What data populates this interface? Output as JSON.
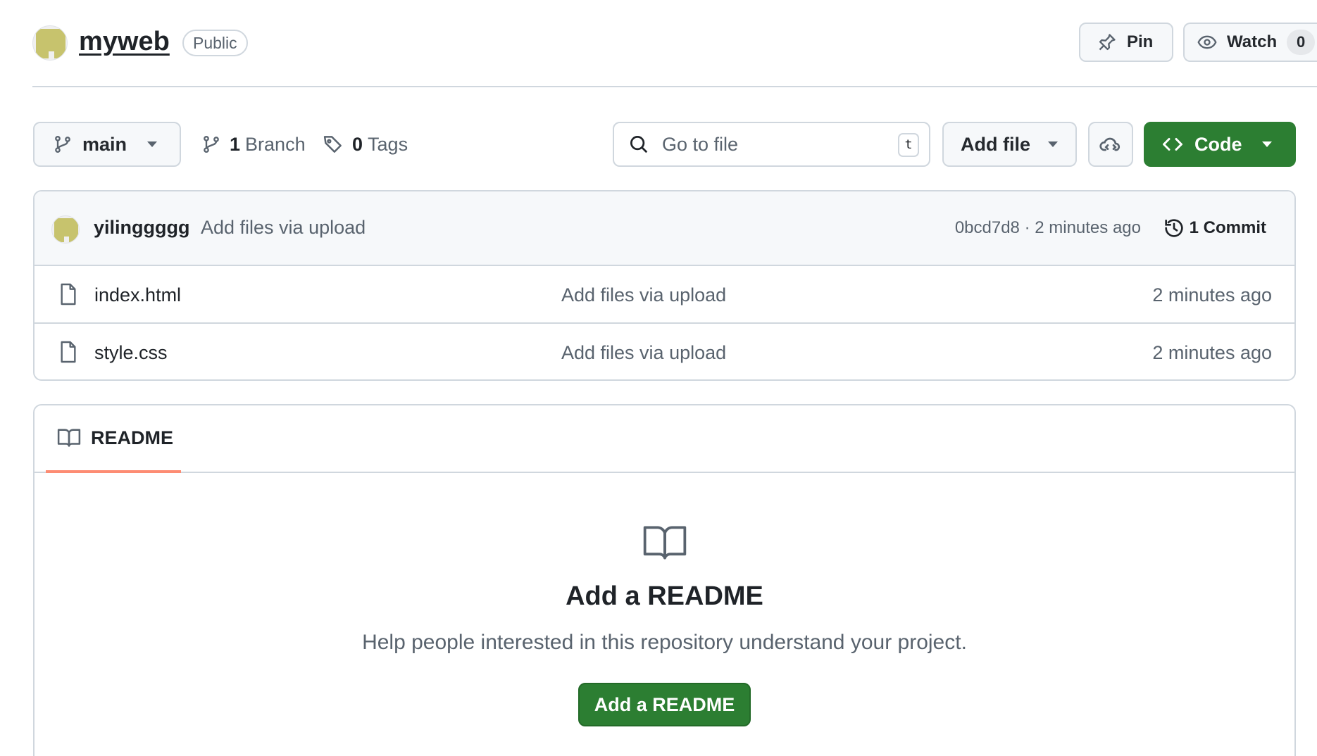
{
  "repo": {
    "name": "myweb",
    "visibility": "Public",
    "actions": {
      "pin_label": "Pin",
      "watch_label": "Watch",
      "watch_count": "0"
    }
  },
  "toolbar": {
    "branch": "main",
    "branch_count": "1",
    "branch_word": "Branch",
    "tag_count": "0",
    "tag_word": "Tags",
    "search_placeholder": "Go to file",
    "search_shortcut": "t",
    "add_file_label": "Add file",
    "code_label": "Code"
  },
  "commit": {
    "author": "yilinggggg",
    "message": "Add files via upload",
    "meta": "0bcd7d8 · 2 minutes ago",
    "count_label": "1 Commit"
  },
  "files": [
    {
      "name": "index.html",
      "message": "Add files via upload",
      "time": "2 minutes ago"
    },
    {
      "name": "style.css",
      "message": "Add files via upload",
      "time": "2 minutes ago"
    }
  ],
  "readme": {
    "tab_label": "README",
    "title": "Add a README",
    "description": "Help people interested in this repository understand your project.",
    "button_label": "Add a README"
  },
  "colors": {
    "primary_green": "#2c7e32",
    "border": "#d0d7de",
    "muted_text": "#59636e",
    "tab_underline": "#fd8c73",
    "avatar": "#c7c36d"
  }
}
